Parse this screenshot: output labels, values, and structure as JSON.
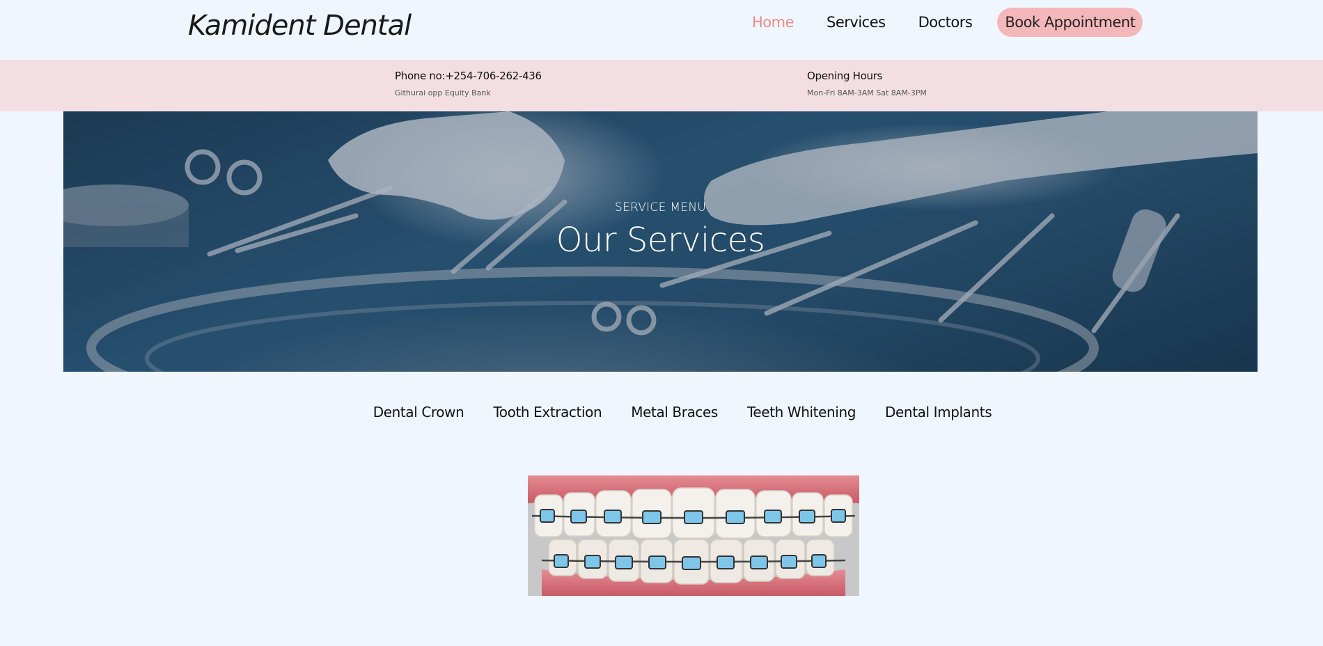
{
  "header": {
    "logo": "Kamident Dental",
    "nav": [
      {
        "label": "Home",
        "active": true
      },
      {
        "label": "Services",
        "active": false
      },
      {
        "label": "Doctors",
        "active": false
      }
    ],
    "cta_label": "Book Appointment"
  },
  "infobar": {
    "contact": {
      "title": "Phone no:+254-706-262-436",
      "detail": "Githurai opp Equity Bank"
    },
    "hours": {
      "title": "Opening Hours",
      "detail": "Mon-Fri 8AM-3AM Sat 8AM-3PM"
    }
  },
  "hero": {
    "kicker": "SERVICE MENU",
    "title": "Our Services"
  },
  "service_tabs": [
    "Dental Crown",
    "Tooth Extraction",
    "Metal Braces",
    "Teeth Whitening",
    "Dental Implants"
  ],
  "colors": {
    "background": "#eff6fe",
    "nav_active": "#ec8a8a",
    "cta_background": "#f5b8ba",
    "infobar_background": "#f3dfe2"
  }
}
